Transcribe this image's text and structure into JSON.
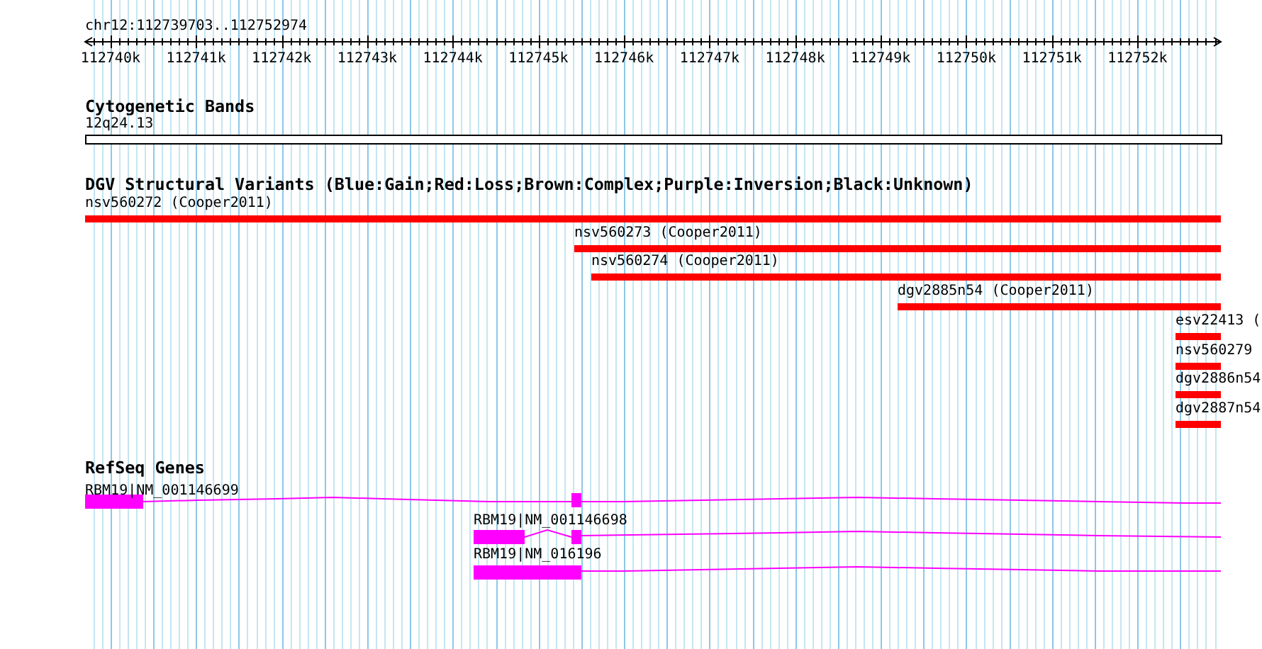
{
  "ruler": {
    "location": "chr12:112739703..112752974",
    "ticks": [
      "112740k",
      "112741k",
      "112742k",
      "112743k",
      "112744k",
      "112745k",
      "112746k",
      "112747k",
      "112748k",
      "112749k",
      "112750k",
      "112751k",
      "112752k"
    ]
  },
  "tracks": [
    {
      "kind": "bands",
      "title": "Cytogenetic Bands",
      "features": [
        {
          "label": "12q24.13"
        }
      ]
    },
    {
      "kind": "variants",
      "title": "DGV Structural Variants (Blue:Gain;Red:Loss;Brown:Complex;Purple:Inversion;Black:Unknown)",
      "features": [
        {
          "label": "nsv560272 (Cooper2011)",
          "color": "#ff0000"
        },
        {
          "label": "nsv560273 (Cooper2011)",
          "color": "#ff0000"
        },
        {
          "label": "nsv560274 (Cooper2011)",
          "color": "#ff0000"
        },
        {
          "label": "dgv2885n54 (Cooper2011)",
          "color": "#ff0000"
        },
        {
          "label": "esv22413 (",
          "color": "#ff0000"
        },
        {
          "label": "nsv560279",
          "color": "#ff0000"
        },
        {
          "label": "dgv2886n54",
          "color": "#ff0000"
        },
        {
          "label": "dgv2887n54",
          "color": "#ff0000"
        }
      ]
    },
    {
      "kind": "genes",
      "title": "RefSeq Genes",
      "features": [
        {
          "label": "RBM19|NM_001146699"
        },
        {
          "label": "RBM19|NM_001146698"
        },
        {
          "label": "RBM19|NM_016196"
        }
      ]
    }
  ]
}
